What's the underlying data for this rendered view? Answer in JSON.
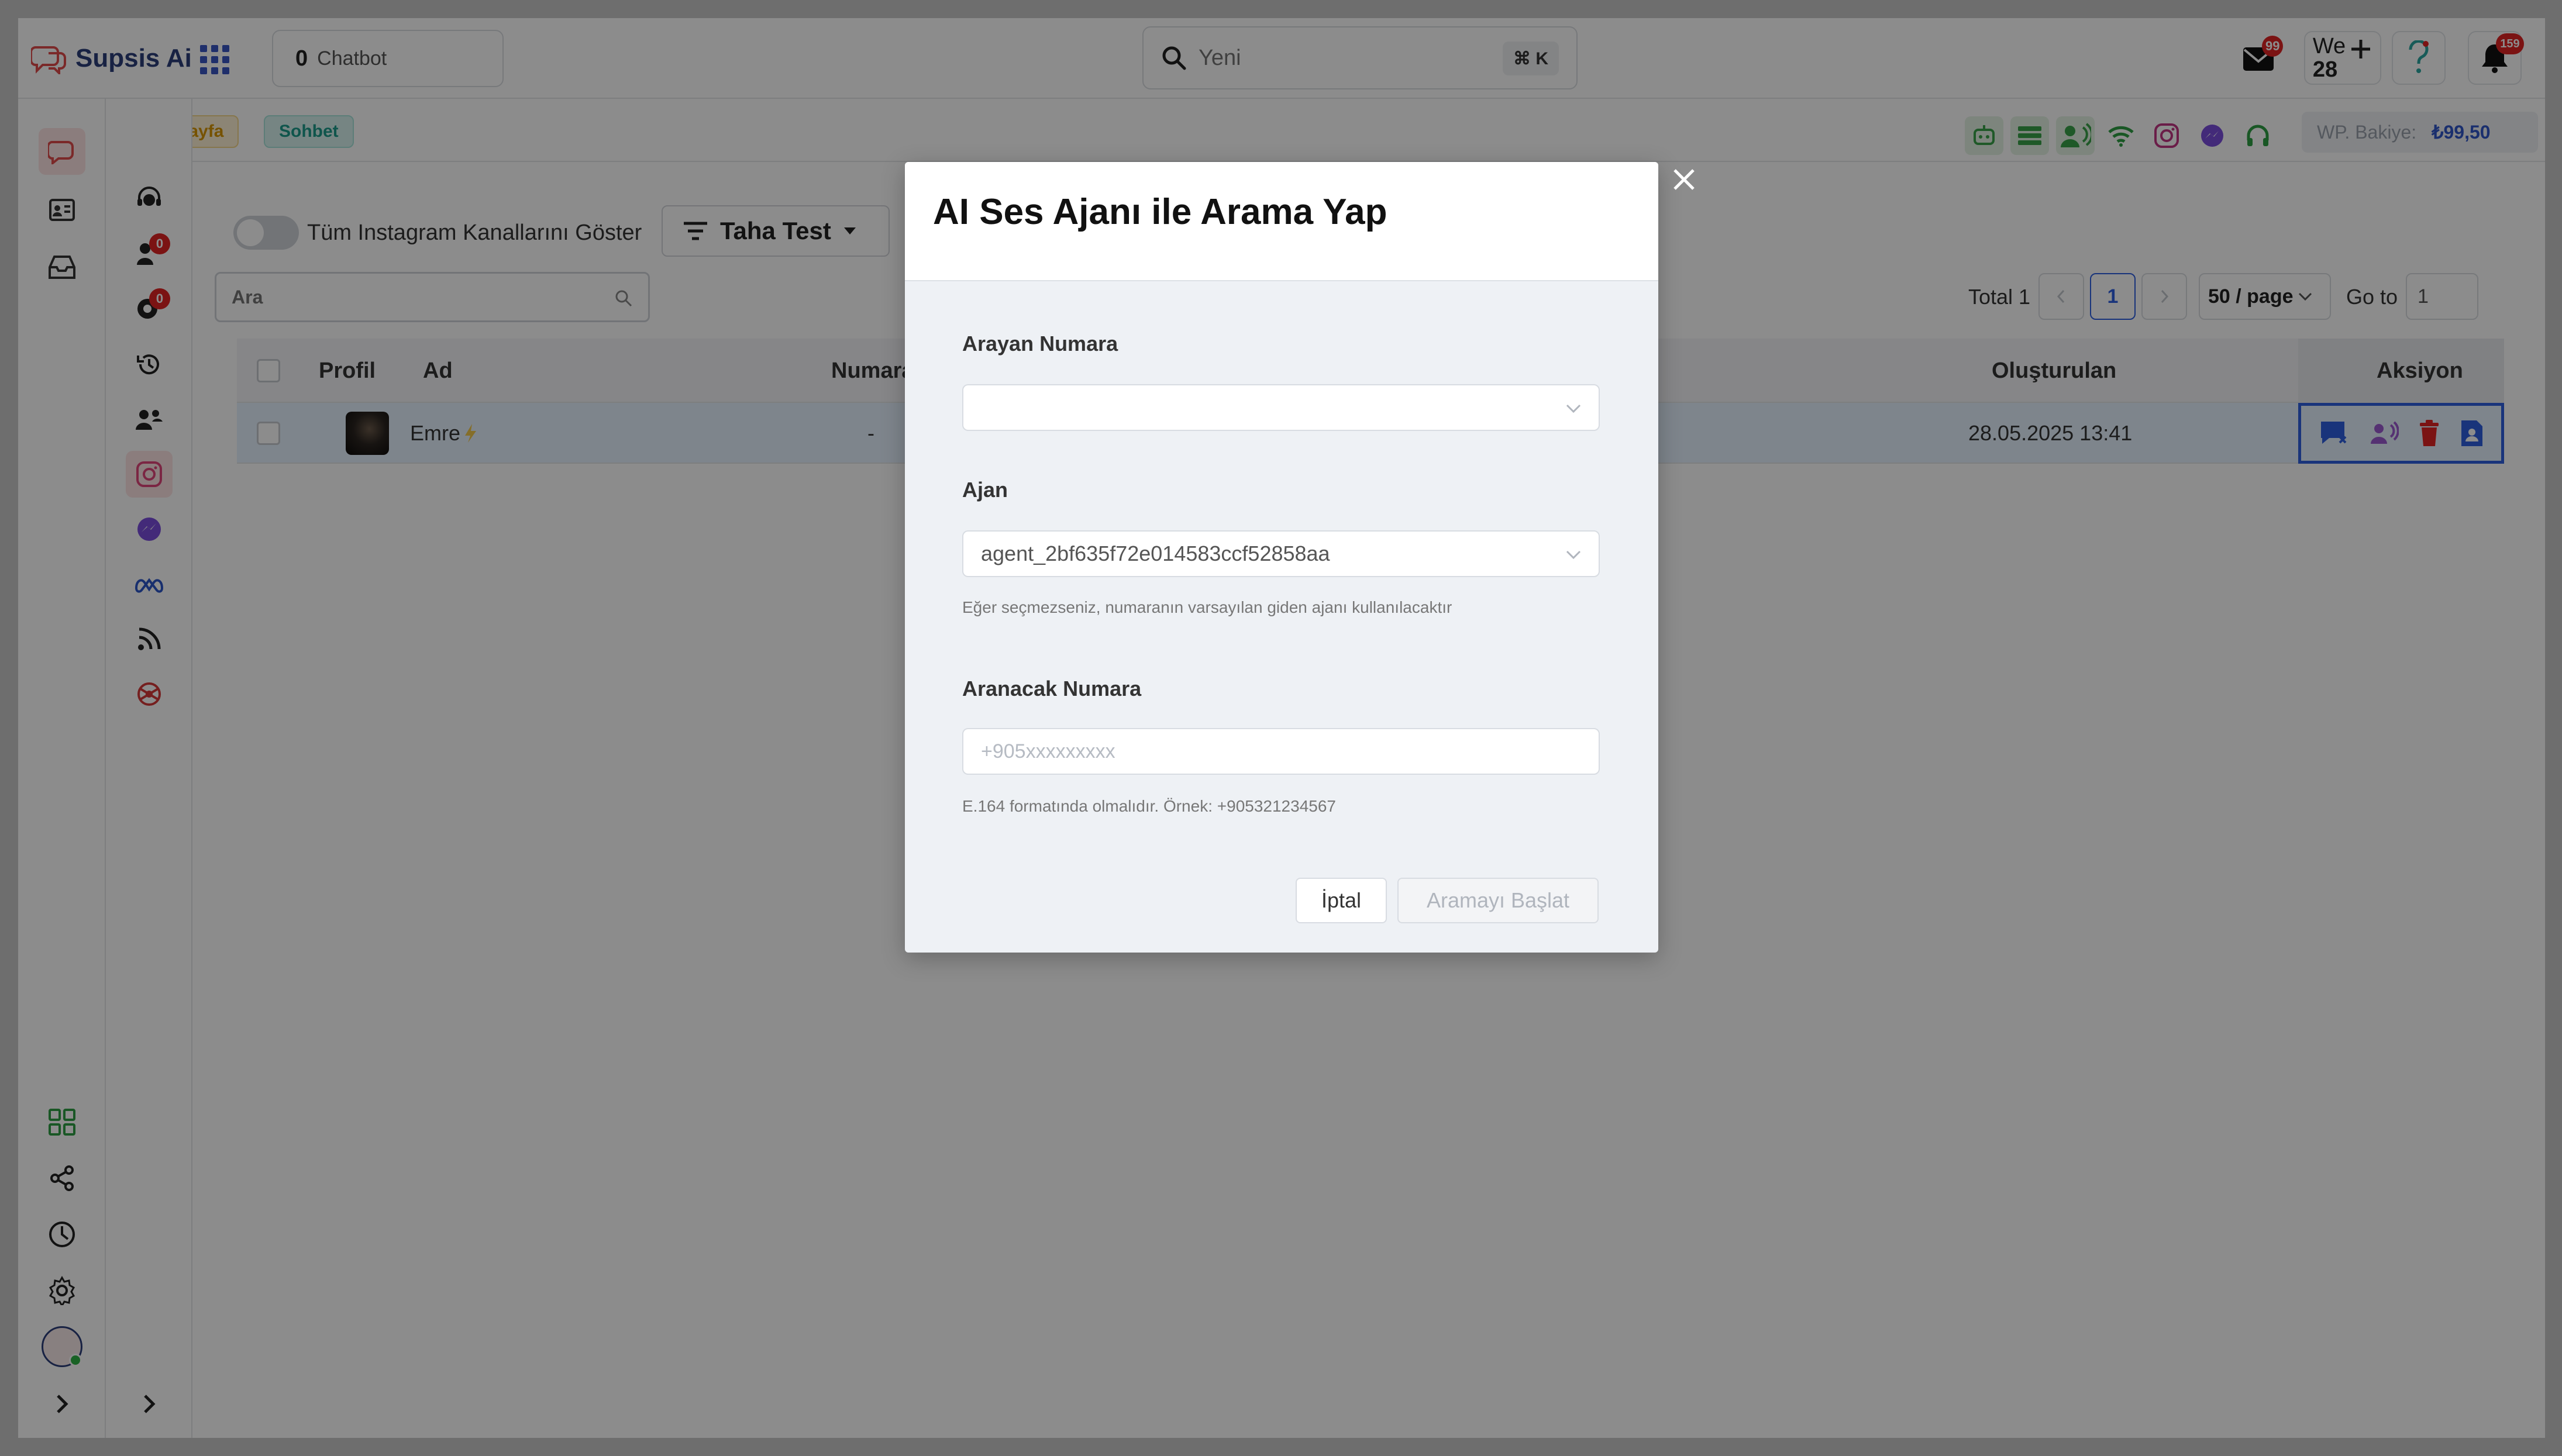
{
  "brand": {
    "name": "Supsis Ai"
  },
  "topbar": {
    "chatbot_count": "0",
    "chatbot_label": "Chatbot",
    "search_placeholder": "Yeni",
    "search_shortcut": "⌘ K",
    "mail_badge": "99",
    "calendar_day_label": "We",
    "calendar_day_number": "28",
    "notification_badge": "159"
  },
  "breadcrumb": {
    "home": "Anasayfa",
    "chat": "Sohbet"
  },
  "balance": {
    "label": "WP. Bakiye:",
    "value": "₺99,50"
  },
  "rail2": {
    "badge_a": "0",
    "badge_b": "0"
  },
  "content": {
    "toggle_label": "Tüm Instagram Kanallarını Göster",
    "filter_label": "Taha Test",
    "search_placeholder": "Ara"
  },
  "pagination": {
    "total": "Total 1",
    "current_page": "1",
    "page_size": "50 / page",
    "goto_label": "Go to",
    "goto_value": "1"
  },
  "table": {
    "headers": {
      "profile": "Profil",
      "name": "Ad",
      "number": "Numara",
      "created": "Oluşturulan",
      "action": "Aksiyon"
    },
    "rows": [
      {
        "name": "Emre",
        "number": "-",
        "created": "28.05.2025 13:41"
      }
    ]
  },
  "modal": {
    "title": "AI Ses Ajanı ile Arama Yap",
    "caller_label": "Arayan Numara",
    "caller_value": "",
    "agent_label": "Ajan",
    "agent_value": "agent_2bf635f72e014583ccf52858aa",
    "agent_help": "Eğer seçmezseniz, numaranın varsayılan giden ajanı kullanılacaktır",
    "callee_label": "Aranacak Numara",
    "callee_placeholder": "+905xxxxxxxxx",
    "callee_help": "E.164 formatında olmalıdır. Örnek: +905321234567",
    "cancel_label": "İptal",
    "start_label": "Aramayı Başlat"
  },
  "colors": {
    "accent": "#2f5fe0",
    "brand": "#2c3e7a",
    "danger": "#e02424",
    "instagram": "#e0457b"
  }
}
